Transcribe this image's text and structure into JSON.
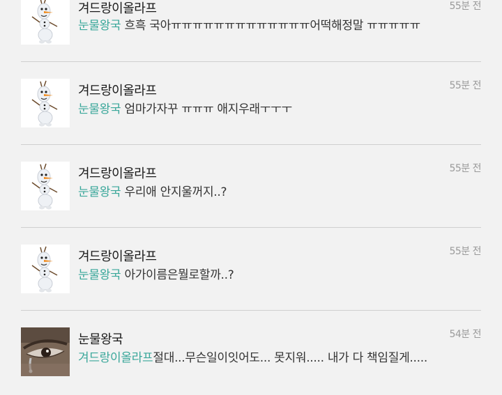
{
  "feed": {
    "items": [
      {
        "author": "겨드랑이올라프",
        "mention": "눈물왕국",
        "text": " 흐흑 국아ㅠㅠㅠㅠㅠㅠㅠㅠㅠㅠㅠㅠㅠ어떡해정말 ㅠㅠㅠㅠㅠ",
        "time": "55분 전",
        "avatar": "olaf-avatar"
      },
      {
        "author": "겨드랑이올라프",
        "mention": "눈물왕국",
        "text": " 엄마가자꾸 ㅠㅠㅠ 애지우래ㅜㅜㅜ",
        "time": "55분 전",
        "avatar": "olaf-avatar"
      },
      {
        "author": "겨드랑이올라프",
        "mention": "눈물왕국",
        "text": " 우리애 안지울꺼지..?",
        "time": "55분 전",
        "avatar": "olaf-avatar"
      },
      {
        "author": "겨드랑이올라프",
        "mention": "눈물왕국",
        "text": " 아가이름은뭘로할까..?",
        "time": "55분 전",
        "avatar": "olaf-avatar"
      },
      {
        "author": "눈물왕국",
        "mention": "겨드랑이올라프",
        "text": "절대...무슨일이잇어도... 못지워..... 내가 다 책임질게.....",
        "time": "54분 전",
        "avatar": "crying-eye-avatar"
      }
    ]
  }
}
